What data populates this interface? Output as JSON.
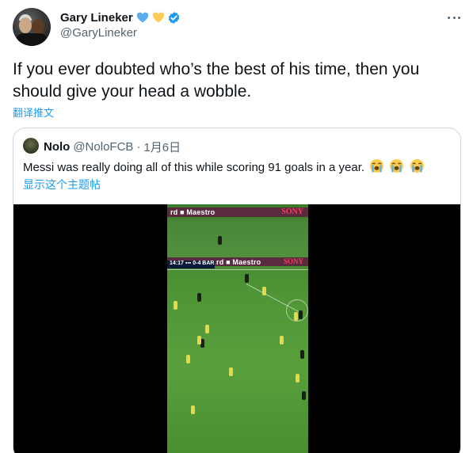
{
  "author": {
    "display_name": "Gary Lineker",
    "handle": "@GaryLineker",
    "emoji_icons": [
      "blue-heart-icon",
      "yellow-heart-icon"
    ],
    "verified_icon": "verified-badge-icon"
  },
  "tweet": {
    "text": "If you ever doubted who’s the best of his time, then you should give your head a wobble.",
    "translate_label": "翻译推文"
  },
  "quoted_tweet": {
    "display_name": "Nolo",
    "handle": "@NoloFCB",
    "separator": "·",
    "date": "1月6日",
    "text": "Messi was really doing all of this while scoring 91 goals in a year.",
    "emoji_icons": [
      "loudly-crying-face-icon",
      "loudly-crying-face-icon",
      "loudly-crying-face-icon"
    ],
    "show_thread_label": "显示这个主题帖",
    "video": {
      "ad_board_text": "rd ■ Maestro",
      "sponsor_text": "SONY",
      "scorebar_text": "14:17 ▪▪▪ 0-4 BAR"
    }
  },
  "colors": {
    "link": "#1d9bf0",
    "secondary_text": "#536471",
    "primary_text": "#0f1419",
    "border": "#cfd9de",
    "pitch": "#59a03c"
  }
}
